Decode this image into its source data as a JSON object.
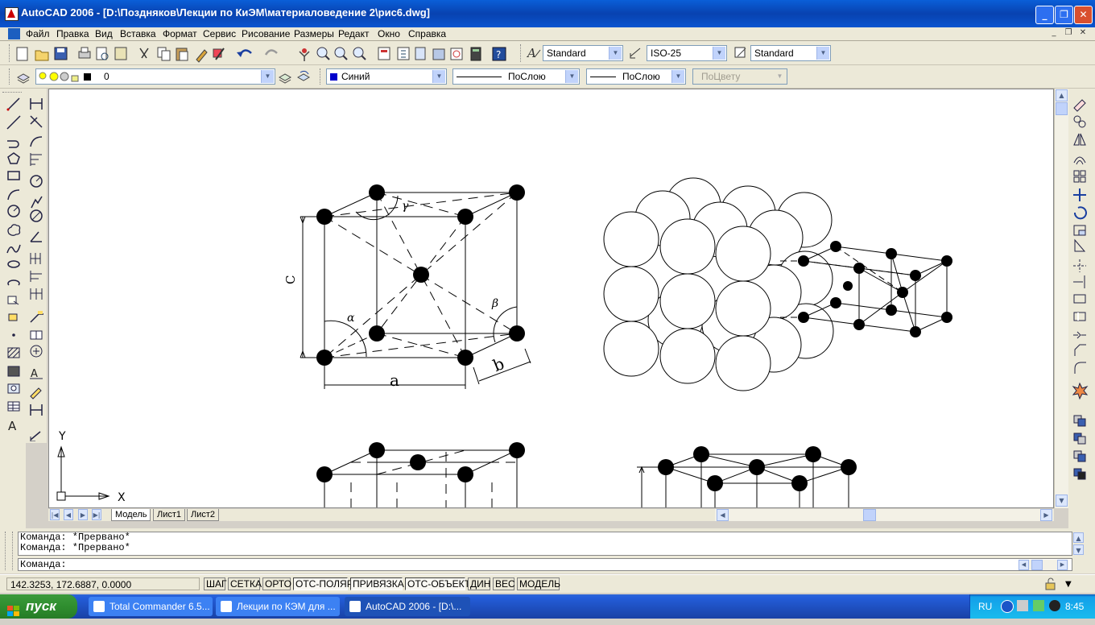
{
  "window": {
    "title": "AutoCAD 2006 - [D:\\Поздняков\\Лекции по КиЭМ\\материаловедение 2\\рис6.dwg]",
    "buttons": [
      "_",
      "❐",
      "✕"
    ]
  },
  "menu": {
    "items": [
      "Файл",
      "Правка",
      "Вид",
      "Вставка",
      "Формат",
      "Сервис",
      "Рисование",
      "Размеры",
      "Редакт",
      "Окно",
      "Справка"
    ],
    "doc_controls": [
      "_",
      "❐",
      "✕"
    ]
  },
  "styles_toolbar": {
    "text_style": "Standard",
    "dim_style": "ISO-25",
    "table_style": "Standard"
  },
  "layers_toolbar": {
    "layer": "0",
    "color": "Синий",
    "color_swatch": "#0000cc",
    "linetype": "ПоСлою",
    "lineweight": "ПоСлою",
    "plotstyle": "ПоЦвету"
  },
  "drawing": {
    "labels": {
      "c": "C",
      "a": "a",
      "b": "b",
      "alpha": "α",
      "beta": "β",
      "gamma": "γ"
    },
    "ucs": {
      "x": "X",
      "y": "Y"
    }
  },
  "tabs": [
    "Модель",
    "Лист1",
    "Лист2"
  ],
  "command": {
    "history": [
      "Команда:  *Прервано*",
      "Команда:  *Прервано*"
    ],
    "prompt": "Команда:"
  },
  "status": {
    "coords": "142.3253, 172.6887, 0.0000",
    "toggles": [
      {
        "label": "ШАГ",
        "on": false
      },
      {
        "label": "СЕТКА",
        "on": false
      },
      {
        "label": "ОРТО",
        "on": false
      },
      {
        "label": "ОТС-ПОЛЯР",
        "on": true
      },
      {
        "label": "ПРИВЯЗКА",
        "on": true
      },
      {
        "label": "ОТС-ОБЪЕКТ",
        "on": true
      },
      {
        "label": "ДИН",
        "on": false
      },
      {
        "label": "ВЕС",
        "on": false
      },
      {
        "label": "МОДЕЛЬ",
        "on": false
      }
    ]
  },
  "taskbar": {
    "start": "пуск",
    "items": [
      "Total Commander 6.5...",
      "Лекции по КЭМ для ...",
      "AutoCAD 2006 - [D:\\..."
    ],
    "lang": "RU",
    "clock": "8:45"
  }
}
